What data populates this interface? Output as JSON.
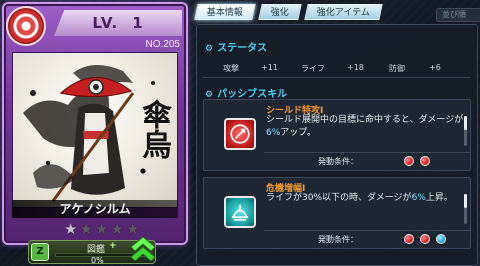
{
  "card": {
    "level_label": "LV.",
    "level_value": "1",
    "number": "NO.205",
    "name": "アケノシルム",
    "calligraphy_top": "傘",
    "calligraphy_bottom": "烏",
    "star_count": 5,
    "stars_filled": 1
  },
  "collection": {
    "icon_text": "Z",
    "label": "図鑑",
    "plus": "+",
    "percent_text": "0%",
    "progress_fraction": 0.0
  },
  "tabs": [
    {
      "label": "基本情報",
      "active": true
    },
    {
      "label": "強化",
      "active": false
    },
    {
      "label": "強化アイテム",
      "active": false
    }
  ],
  "tab_hint": "並び順",
  "status": {
    "heading": "ステータス",
    "stats": [
      {
        "name": "攻撃",
        "value": "+11"
      },
      {
        "name": "ライフ",
        "value": "+18"
      },
      {
        "name": "防御",
        "value": "+6"
      }
    ]
  },
  "passive": {
    "heading": "パッシブスキル",
    "skills": [
      {
        "title": "シールド特攻Ⅰ",
        "desc_pre": "シールド展開中の目標に命中すると、ダメージが",
        "desc_hl": "6%",
        "desc_post": "アップ。",
        "condition_label": "発動条件：",
        "icon": "shield-strike-icon",
        "icon_color": "red",
        "orbs": [
          "red",
          "red"
        ]
      },
      {
        "title": "危機増幅Ⅰ",
        "desc_pre": "ライフが30%以下の時、ダメージが",
        "desc_hl": "6%",
        "desc_post": "上昇。",
        "condition_label": "発動条件：",
        "icon": "crisis-boost-icon",
        "icon_color": "teal",
        "orbs": [
          "red",
          "red",
          "blue"
        ]
      }
    ]
  },
  "colors": {
    "accent": "#4fd0f0",
    "skill_title": "#f39a2c",
    "card_frame": "#9d5fc8"
  }
}
